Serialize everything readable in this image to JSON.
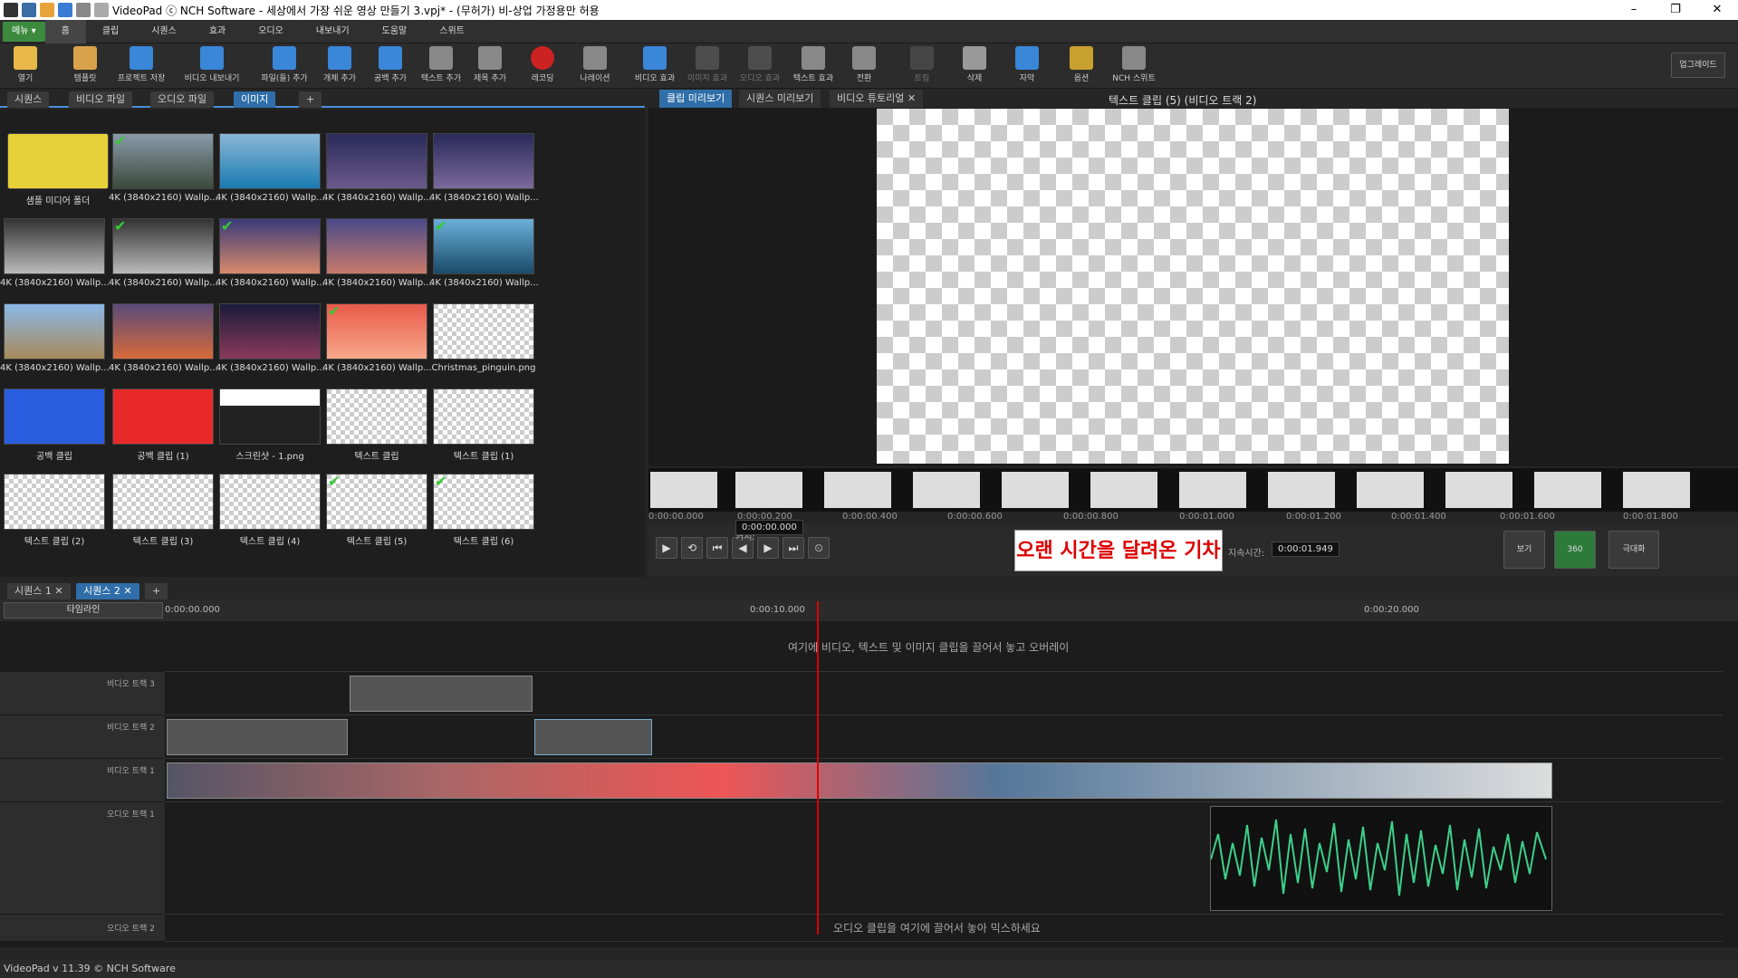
{
  "window": {
    "title": "VideoPad ⓒ NCH Software - 세상에서 가장 쉬운 영상 만들기 3.vpj* - (무허가) 비-상업 가정용만 허용",
    "min": "–",
    "max": "❐",
    "close": "✕"
  },
  "menu": {
    "main_label": "메뉴 ▾",
    "tabs": [
      "홈",
      "클립",
      "시퀀스",
      "효과",
      "오디오",
      "내보내기",
      "도움말",
      "스위트"
    ]
  },
  "toolbar": {
    "items": [
      "열기",
      "템플릿",
      "프로젝트 저장",
      "비디오 내보내기",
      "파일(들) 추가",
      "개체 추가",
      "공백 추가",
      "텍스트 추가",
      "제목 추가",
      "레코딩",
      "나레이션",
      "비디오 효과",
      "이미지 효과",
      "오디오 효과",
      "텍스트 효과",
      "전환",
      "트림",
      "삭제",
      "자막",
      "옵션",
      "NCH 스위트"
    ],
    "upgrade": "업그레이드"
  },
  "bin": {
    "tabs": [
      "시퀀스",
      "비디오 파일",
      "오디오 파일",
      "이미지",
      "+"
    ],
    "items": [
      "샘플 미디어 폴더",
      "4K (3840x2160) Wallp...",
      "4K (3840x2160) Wallp...",
      "4K (3840x2160) Wallp...",
      "4K (3840x2160) Wallp...",
      "4K (3840x2160) Wallp...",
      "4K (3840x2160) Wallp...",
      "4K (3840x2160) Wallp...",
      "4K (3840x2160) Wallp...",
      "4K (3840x2160) Wallp...",
      "4K (3840x2160) Wallp...",
      "4K (3840x2160) Wallp...",
      "4K (3840x2160) Wallp...",
      "4K (3840x2160) Wallp...",
      "Christmas_pinguin.png",
      "공백 클립",
      "공백 클립 (1)",
      "스크린샷 - 1.png",
      "텍스트 클립",
      "텍스트 클립 (1)",
      "텍스트 클립 (2)",
      "텍스트 클립 (3)",
      "텍스트 클립 (4)",
      "텍스트 클립 (5)",
      "텍스트 클립 (6)"
    ]
  },
  "preview": {
    "tabs": [
      "클립 미리보기",
      "시퀀스 미리보기",
      "비디오 튜토리얼 ✕"
    ],
    "title": "텍스트 클립 (5) (비디오 트랙 2)",
    "ruler": [
      "0:00:00.000",
      "0:00:00.200",
      "0:00:00.400",
      "0:00:00.600",
      "0:00:00.800",
      "0:00:01.000",
      "0:00:01.200",
      "0:00:01.400",
      "0:00:01.600",
      "0:00:01.800"
    ],
    "cursor_label": "커서:",
    "cursor": "0:00:00.000",
    "duration_label": "지속시간:",
    "duration": "0:00:01.949",
    "text": "오랜 시간을 달려온 기차",
    "view": "보기",
    "fullscreen": "극대화"
  },
  "timeline": {
    "tabs": [
      "시퀀스 1 ✕",
      "시퀀스 2 ✕",
      "+"
    ],
    "mode": "타임라인",
    "ruler": [
      "0:00:00.000",
      "0:00:10.000",
      "0:00:20.000"
    ],
    "overlay_hint": "여기에 비디오, 텍스트 및 이미지 클립을 끌어서 놓고 오버레이",
    "tracks": [
      "비디오 트랙 3",
      "비디오 트랙 2",
      "비디오 트랙 1",
      "오디오 트랙 1",
      "오디오 트랙 2"
    ],
    "audio_hint": "오디오 클립을 여기에 끌어서 놓아 믹스하세요"
  },
  "status": {
    "version": "VideoPad v 11.39 © NCH Software"
  }
}
